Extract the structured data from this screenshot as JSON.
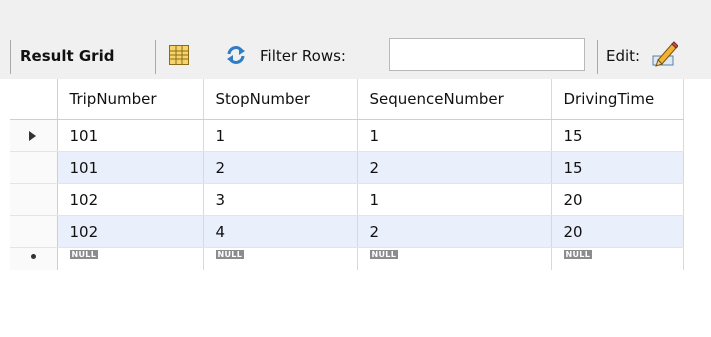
{
  "toolbar": {
    "result_grid_label": "Result Grid",
    "filter_label": "Filter Rows:",
    "filter_value": "",
    "edit_label": "Edit:",
    "icons": {
      "grid_layout": "form-grid-icon",
      "refresh": "refresh-arrows-icon",
      "edit": "pencil-edit-icon"
    }
  },
  "grid": {
    "columns": [
      "TripNumber",
      "StopNumber",
      "SequenceNumber",
      "DrivingTime"
    ],
    "rows": [
      [
        "101",
        "1",
        "1",
        "15"
      ],
      [
        "101",
        "2",
        "2",
        "15"
      ],
      [
        "102",
        "3",
        "1",
        "20"
      ],
      [
        "102",
        "4",
        "2",
        "20"
      ]
    ],
    "new_row": [
      "NULL",
      "NULL",
      "NULL",
      "NULL"
    ],
    "selected_row_index": 0
  },
  "colors": {
    "alt_row": "#e9f0fb",
    "toolbar_bg": "#f0f0f0",
    "null_badge": "#8c8c8c"
  }
}
